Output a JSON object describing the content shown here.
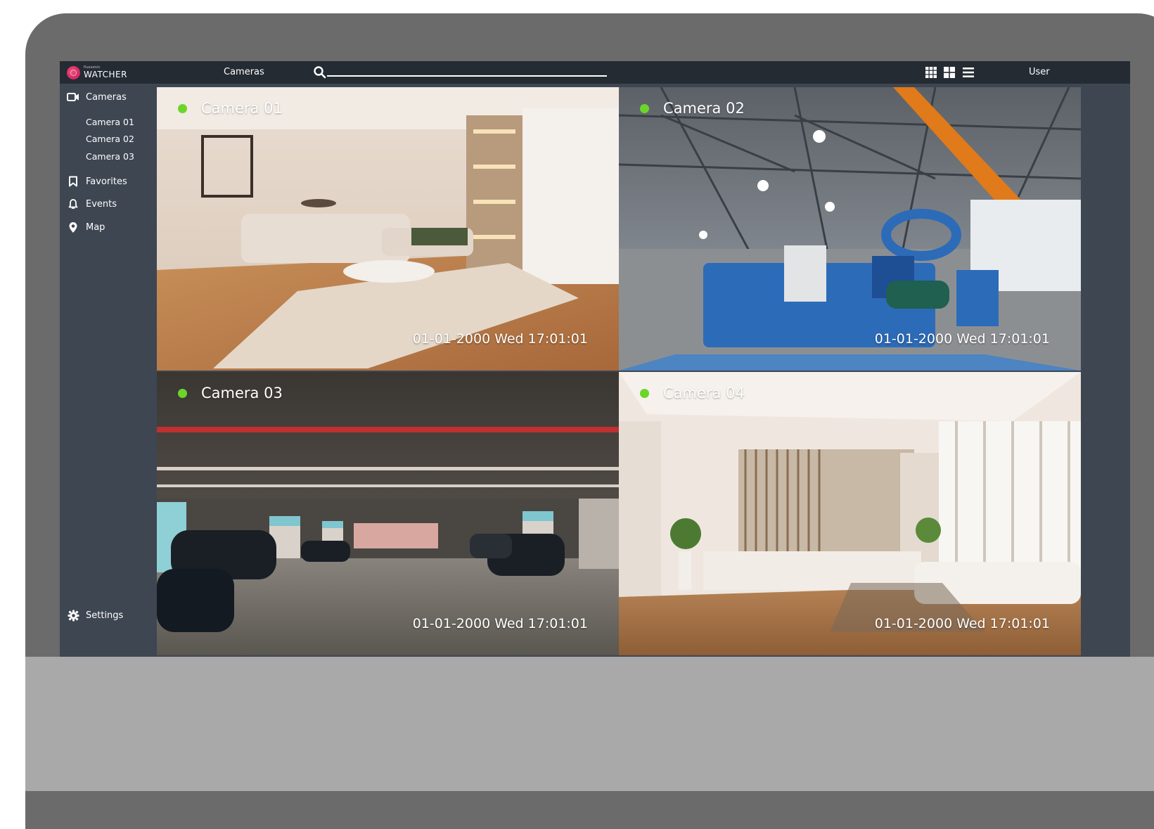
{
  "app": {
    "logo_small": "flussonic",
    "logo_name": "WATCHER",
    "brand_color": "#e0336b"
  },
  "topbar": {
    "nav_label": "Cameras",
    "user_label": "User",
    "view_buttons": [
      "grid-large-icon",
      "grid-small-icon",
      "list-icon"
    ]
  },
  "sidebar": {
    "cameras": {
      "label": "Cameras",
      "icon": "video-camera-icon"
    },
    "camera_list": [
      "Camera 01",
      "Camera 02",
      "Camera 03"
    ],
    "favorites": {
      "label": "Favorites",
      "icon": "bookmark-icon"
    },
    "events": {
      "label": "Events",
      "icon": "bell-icon"
    },
    "map": {
      "label": "Map",
      "icon": "location-pin-icon"
    },
    "settings": {
      "label": "Settings",
      "icon": "gear-icon"
    }
  },
  "cameras": [
    {
      "name": "Camera 01",
      "timestamp": "01-01-2000 Wed 17:01:01",
      "status_color": "#6bd629"
    },
    {
      "name": "Camera 02",
      "timestamp": "01-01-2000 Wed 17:01:01",
      "status_color": "#6bd629"
    },
    {
      "name": "Camera 03",
      "timestamp": "01-01-2000 Wed 17:01:01",
      "status_color": "#6bd629"
    },
    {
      "name": "Camera 04",
      "timestamp": "01-01-2000 Wed 17:01:01",
      "status_color": "#6bd629"
    }
  ]
}
